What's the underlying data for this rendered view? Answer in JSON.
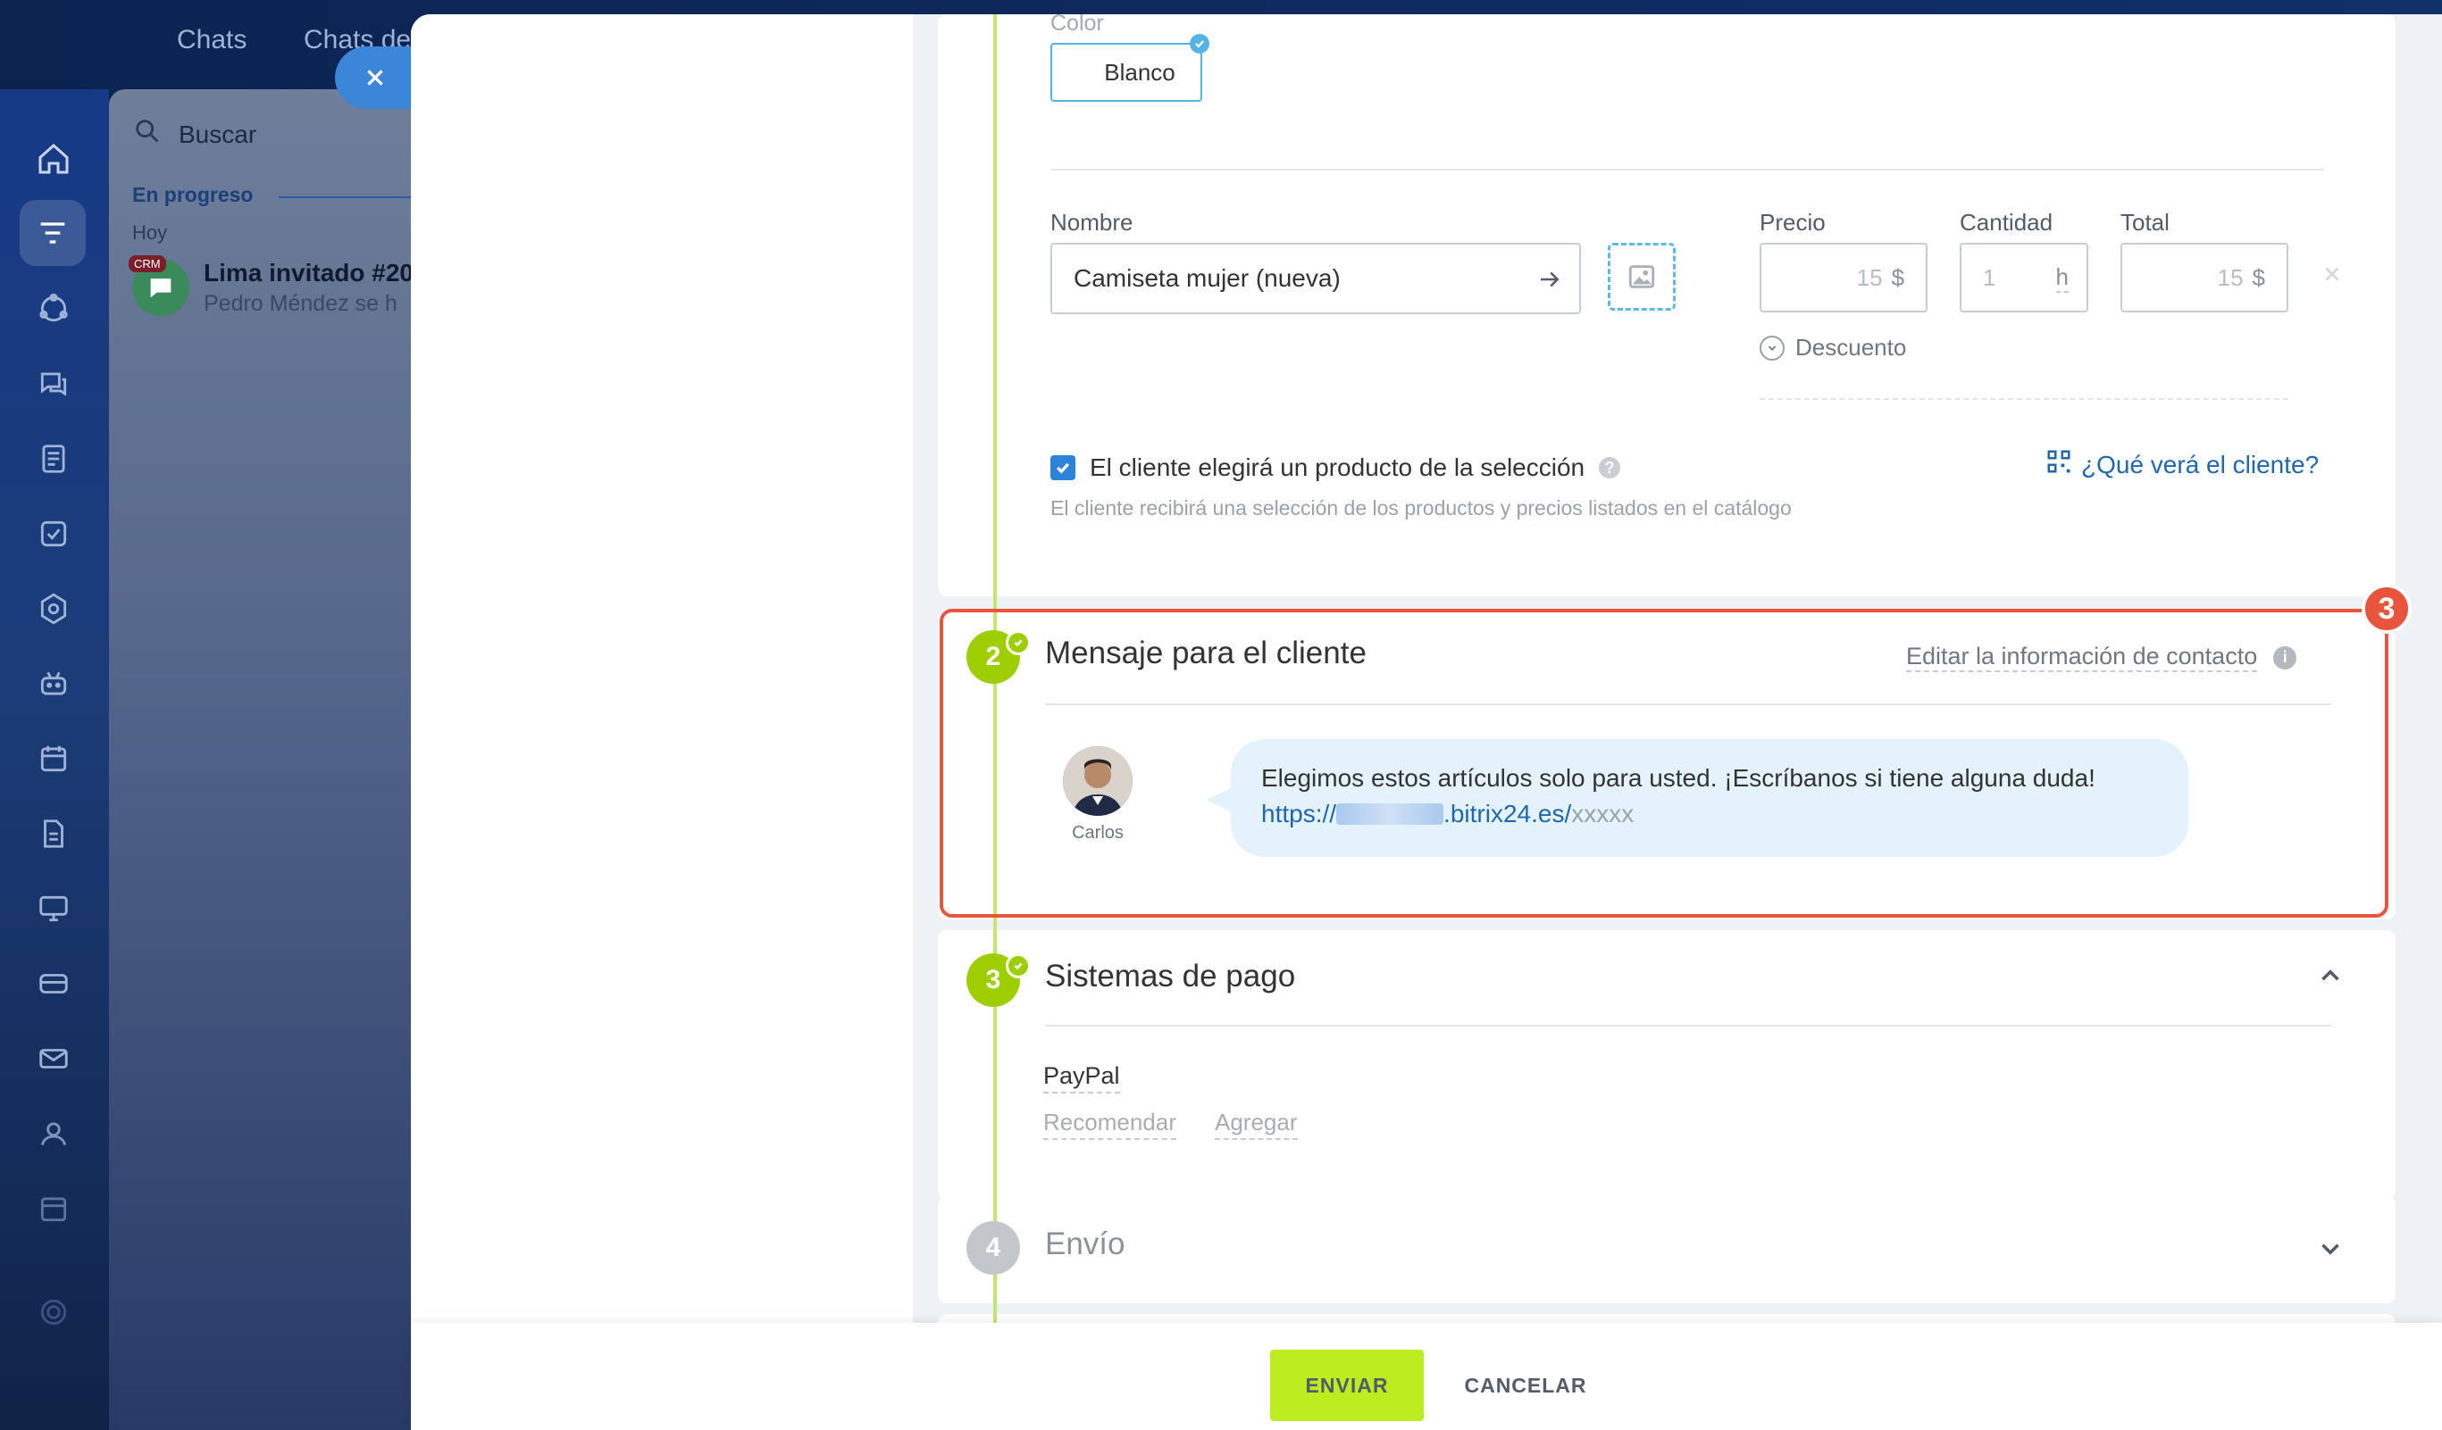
{
  "top_tabs": [
    "Chats",
    "Chats de"
  ],
  "chat_list": {
    "search_placeholder": "Buscar",
    "group_label": "En progreso",
    "date_label": "Hoy",
    "item": {
      "badge": "CRM",
      "title": "Lima invitado #20",
      "subtitle": "Pedro Méndez se h"
    }
  },
  "variant": {
    "color_label": "Color",
    "color_value": "Blanco"
  },
  "product": {
    "name_label": "Nombre",
    "name_value": "Camiseta mujer (nueva)",
    "price_label": "Precio",
    "price_value": "15",
    "price_currency": "$",
    "qty_label": "Cantidad",
    "qty_value": "1",
    "qty_unit": "h",
    "total_label": "Total",
    "total_value": "15",
    "total_currency": "$",
    "discount_label": "Descuento",
    "selection_checkbox_label": "El cliente elegirá un producto de la selección",
    "selection_checked": true,
    "selection_hint": "El cliente recibirá una selección de los productos y precios listados en el catálogo",
    "preview_link": "¿Qué verá el cliente?"
  },
  "message_section": {
    "step": "2",
    "title": "Mensaje para el cliente",
    "edit_contact_link": "Editar la información de contacto",
    "sender_name": "Carlos",
    "message_text": "Elegimos estos artículos solo para usted. ¡Escríbanos si tiene alguna duda!",
    "link_prefix": "https://",
    "link_domain": ".bitrix24.es/",
    "link_suffix": "xxxxx",
    "annotation_number": "3"
  },
  "payment_section": {
    "step": "3",
    "title": "Sistemas de pago",
    "system_name": "PayPal",
    "recommend_link": "Recomendar",
    "add_link": "Agregar"
  },
  "delivery_section": {
    "step": "4",
    "title": "Envío"
  },
  "footer": {
    "send_label": "ENVIAR",
    "cancel_label": "CANCELAR"
  },
  "colors": {
    "accent_green": "#bbed21",
    "step_green": "#9dcf00",
    "link_blue": "#2067b0",
    "highlight_red": "#e8553c"
  }
}
